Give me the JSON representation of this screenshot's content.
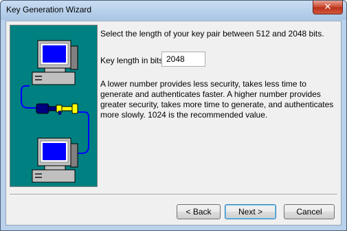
{
  "window": {
    "title": "Key Generation Wizard",
    "close_label": "✕"
  },
  "content": {
    "instruction": "Select the length of your key pair between 512 and 2048 bits.",
    "key_length_label": "Key length in bits:",
    "key_length_value": "2048",
    "description": "A lower number provides less security, takes less time to generate and authenticates faster. A higher number provides greater security, takes more time to generate, and authenticates more slowly. 1024 is the recommended value."
  },
  "buttons": {
    "back": "< Back",
    "next": "Next >",
    "cancel": "Cancel"
  },
  "colors": {
    "art_background": "#008080",
    "cable": "#0000ff",
    "key_blue": "#000080",
    "key_yellow": "#ffff00"
  }
}
